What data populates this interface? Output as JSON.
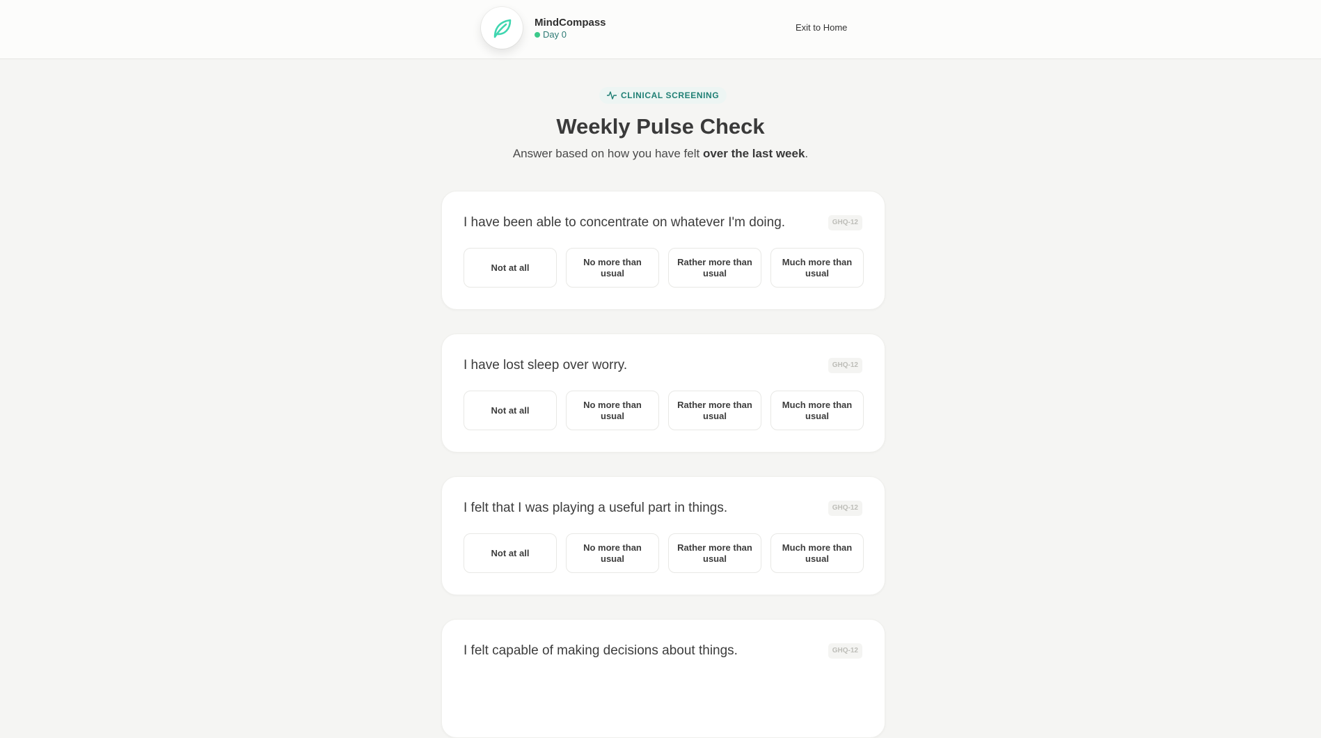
{
  "header": {
    "brand_name": "MindCompass",
    "day_label": "Day 0",
    "exit_label": "Exit to Home",
    "logo_icon": "leaf-icon"
  },
  "intro": {
    "tag_label": "CLINICAL SCREENING",
    "title": "Weekly Pulse Check",
    "subtitle_prefix": "Answer based on how you have felt ",
    "subtitle_emphasis": "over the last week",
    "subtitle_suffix": "."
  },
  "questions": [
    {
      "text": "I have been able to concentrate on whatever I'm doing.",
      "tag": "GHQ-12",
      "options": [
        "Not at all",
        "No more than usual",
        "Rather more than usual",
        "Much more than usual"
      ]
    },
    {
      "text": "I have lost sleep over worry.",
      "tag": "GHQ-12",
      "options": [
        "Not at all",
        "No more than usual",
        "Rather more than usual",
        "Much more than usual"
      ]
    },
    {
      "text": "I felt that I was playing a useful part in things.",
      "tag": "GHQ-12",
      "options": [
        "Not at all",
        "No more than usual",
        "Rather more than usual",
        "Much more than usual"
      ]
    },
    {
      "text": "I felt capable of making decisions about things.",
      "tag": "GHQ-12",
      "options": []
    }
  ],
  "colors": {
    "accent": "#1f7f74",
    "status_dot": "#3cc98a",
    "logo": "#3fd6b0"
  }
}
